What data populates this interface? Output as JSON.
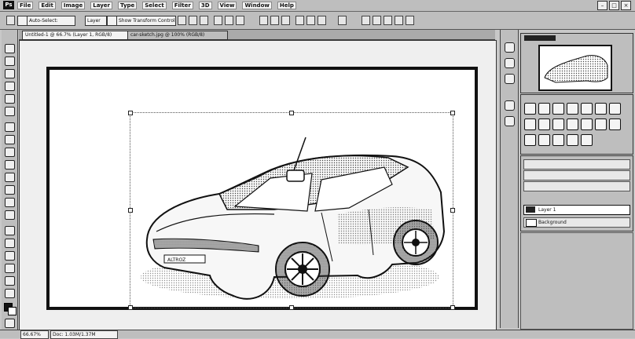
{
  "menu": {
    "logo": "Ps",
    "items": [
      "File",
      "Edit",
      "Image",
      "Layer",
      "Type",
      "Select",
      "Filter",
      "3D",
      "View",
      "Window",
      "Help"
    ]
  },
  "window_controls": [
    "–",
    "□",
    "×"
  ],
  "options": {
    "auto_select_label": "Auto-Select:",
    "auto_select_value": "Layer",
    "show_transform_label": "Show Transform Controls"
  },
  "document_tabs": [
    {
      "label": "Untitled-1 @ 66.7% (Layer 1, RGB/8)",
      "active": true
    },
    {
      "label": "car-sketch.jpg @ 100% (RGB/8)",
      "active": false
    }
  ],
  "layers": {
    "items": [
      {
        "name": "Layer 1",
        "selected": true
      },
      {
        "name": "Background",
        "selected": false
      }
    ]
  },
  "status": {
    "zoom": "66.67%",
    "doc_size": "Doc: 1.03M/1.37M"
  },
  "colors": {
    "foreground": "#111111",
    "background": "#ffffff",
    "panel": "#c8c8c8"
  },
  "icons": {
    "toolbox": [
      "move-icon",
      "marquee-icon",
      "lasso-icon",
      "quick-select-icon",
      "crop-icon",
      "eyedropper-icon",
      "healing-icon",
      "brush-icon",
      "clone-stamp-icon",
      "history-brush-icon",
      "eraser-icon",
      "gradient-icon",
      "blur-icon",
      "dodge-icon",
      "pen-icon",
      "type-icon",
      "path-select-icon",
      "shape-icon",
      "hand-icon",
      "zoom-icon"
    ],
    "dock": [
      "history-icon",
      "actions-icon",
      "properties-icon"
    ]
  }
}
